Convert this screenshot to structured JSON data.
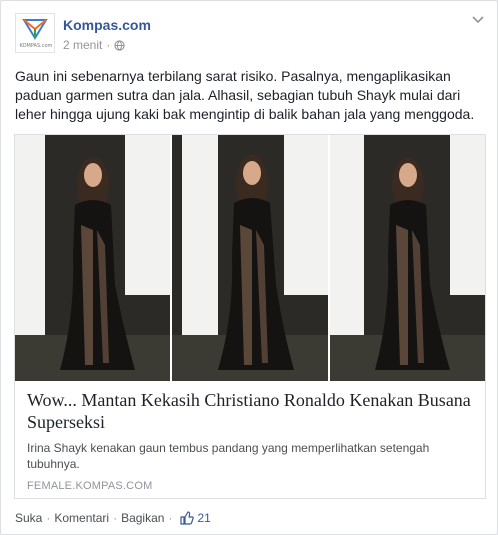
{
  "post": {
    "page_name": "Kompas.com",
    "timestamp": "2 menit",
    "audience_icon": "globe-icon",
    "avatar_text": "KOMPAS.com",
    "text": "Gaun ini sebenarnya terbilang sarat risiko. Pasalnya, mengaplikasikan paduan garmen sutra dan jala. Alhasil, sebagian tubuh Shayk mulai dari leher hingga ujung kaki bak mengintip di balik bahan jala yang menggoda."
  },
  "attachment": {
    "title": "Wow... Mantan Kekasih Christiano Ronaldo Kenakan Busana Superseksi",
    "description": "Irina Shayk kenakan gaun tembus pandang yang memperlihatkan setengah tubuhnya.",
    "domain": "FEMALE.KOMPAS.COM"
  },
  "actions": {
    "like": "Suka",
    "comment": "Komentari",
    "share": "Bagikan",
    "like_count": "21",
    "separator": "·"
  },
  "colors": {
    "link": "#365899",
    "meta": "#90949c",
    "text": "#1d2129"
  }
}
